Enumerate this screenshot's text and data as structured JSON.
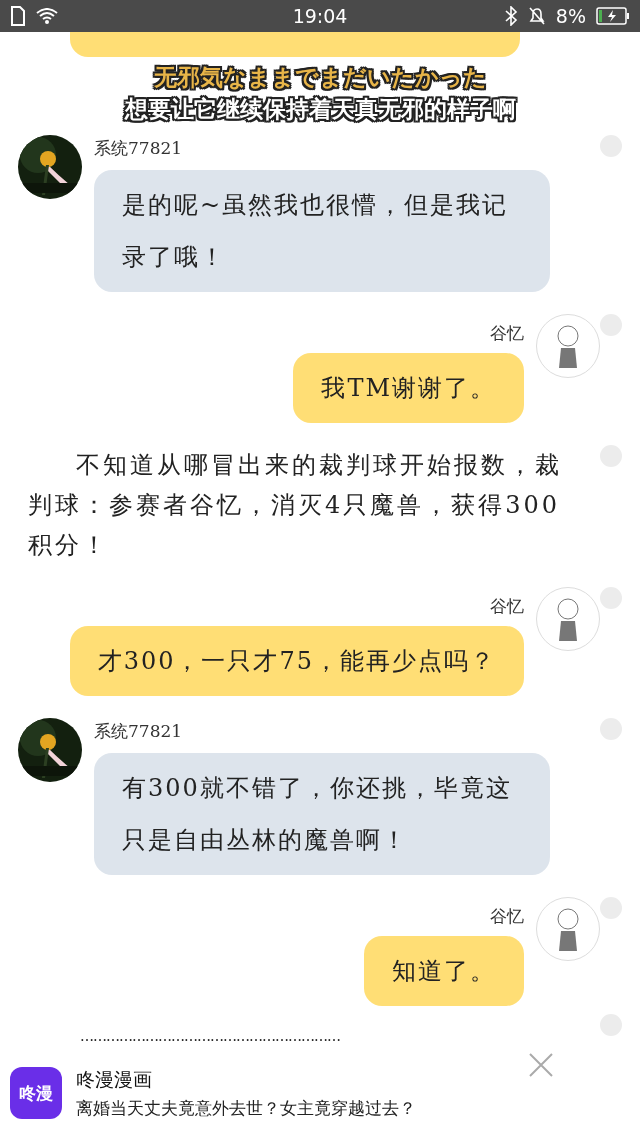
{
  "status_bar": {
    "time": "19:04",
    "battery": "8%"
  },
  "messages": [
    {
      "kind": "cut"
    },
    {
      "kind": "received",
      "name": "系统77821",
      "text": "是的呢~虽然我也很懵，但是我记录了哦！"
    },
    {
      "kind": "sent",
      "name": "谷忆",
      "text": "我TM谢谢了。"
    },
    {
      "kind": "narration",
      "text": "不知道从哪冒出来的裁判球开始报数，裁判球：参赛者谷忆，消灭4只魔兽，获得300积分！"
    },
    {
      "kind": "sent",
      "name": "谷忆",
      "text": "才300，一只才75，能再少点吗？"
    },
    {
      "kind": "received",
      "name": "系统77821",
      "text": "有300就不错了，你还挑，毕竟这只是自由丛林的魔兽啊！"
    },
    {
      "kind": "sent",
      "name": "谷忆",
      "text": "知道了。"
    },
    {
      "kind": "ellipsis",
      "text": "……………………………………………………"
    }
  ],
  "subtitles": [
    "无邪気なままでまだいたかった",
    "想要让它继续保持着天真无邪的样子啊"
  ],
  "ad": {
    "app": "咚漫",
    "title": "咚漫漫画",
    "text": "离婚当天丈夫竟意外去世？女主竟穿越过去？"
  }
}
